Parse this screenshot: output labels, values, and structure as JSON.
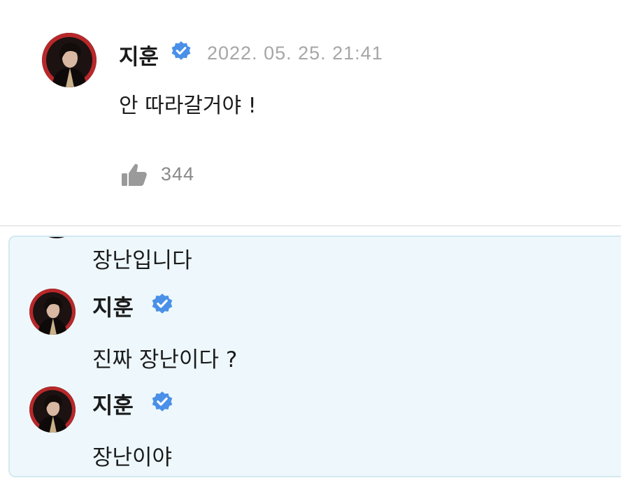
{
  "post": {
    "author": "지훈",
    "verified_icon": "verified-badge-icon",
    "timestamp": "2022. 05. 25. 21:41",
    "text": "안 따라갈거야 !",
    "like_icon": "thumbs-up-icon",
    "like_count": "344"
  },
  "replies": {
    "partial_text": "장난입니다",
    "items": [
      {
        "author": "지훈",
        "text": "진짜 장난이다 ?"
      },
      {
        "author": "지훈",
        "text": "장난이야"
      }
    ]
  },
  "colors": {
    "verified": "#4a90e8",
    "timestamp": "#a6a6a6",
    "like": "#9a9a9a",
    "reply_bg": "#eef8fc",
    "reply_border": "#d3e9f2"
  }
}
